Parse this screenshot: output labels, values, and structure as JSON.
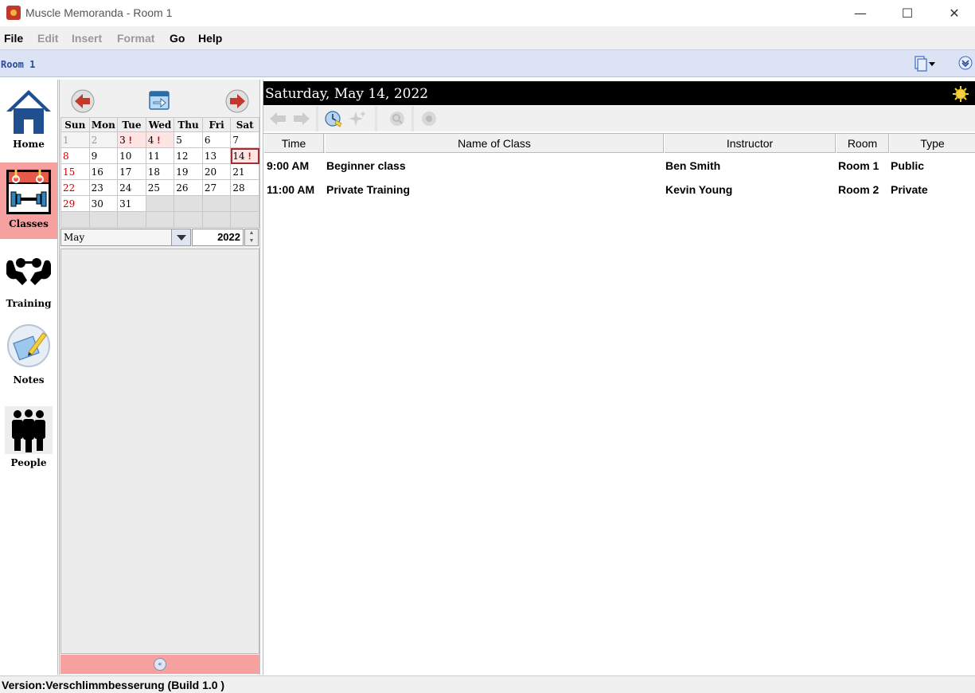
{
  "window": {
    "title": "Muscle Memoranda - Room 1",
    "controls": {
      "minimize": "—",
      "maximize": "☐",
      "close": "✕"
    }
  },
  "menu": {
    "items": [
      {
        "label": "File",
        "enabled": true
      },
      {
        "label": "Edit",
        "enabled": false
      },
      {
        "label": "Insert",
        "enabled": false
      },
      {
        "label": "Format",
        "enabled": false
      },
      {
        "label": "Go",
        "enabled": true
      },
      {
        "label": "Help",
        "enabled": true
      }
    ]
  },
  "room_bar": {
    "label": "Room 1"
  },
  "nav": {
    "items": [
      {
        "label": "Home",
        "icon": "home-icon",
        "active": false
      },
      {
        "label": "Classes",
        "icon": "classes-icon",
        "active": true
      },
      {
        "label": "Training",
        "icon": "training-icon",
        "active": false
      },
      {
        "label": "Notes",
        "icon": "notes-icon",
        "active": false
      },
      {
        "label": "People",
        "icon": "people-icon",
        "active": false
      }
    ]
  },
  "calendar": {
    "weekdays": [
      "Sun",
      "Mon",
      "Tue",
      "Wed",
      "Thu",
      "Fri",
      "Sat"
    ],
    "weeks": [
      [
        "1",
        "2",
        "3",
        "4",
        "5",
        "6",
        "7"
      ],
      [
        "8",
        "9",
        "10",
        "11",
        "12",
        "13",
        "14"
      ],
      [
        "15",
        "16",
        "17",
        "18",
        "19",
        "20",
        "21"
      ],
      [
        "22",
        "23",
        "24",
        "25",
        "26",
        "27",
        "28"
      ],
      [
        "29",
        "30",
        "31",
        "",
        "",
        "",
        ""
      ],
      [
        "",
        "",
        "",
        "",
        "",
        "",
        ""
      ]
    ],
    "event_marker": "!",
    "event_days": [
      "3",
      "4",
      "14"
    ],
    "selected_day": "14",
    "month": "May",
    "year": "2022",
    "accent_color": "#f7a0a0"
  },
  "main": {
    "date_header": "Saturday, May 14, 2022",
    "columns": [
      "Time",
      "Name of Class",
      "Instructor",
      "Room",
      "Type"
    ],
    "rows": [
      {
        "time": "9:00 AM",
        "name": "Beginner class",
        "instructor": "Ben Smith",
        "room": "Room 1",
        "type": "Public"
      },
      {
        "time": "11:00 AM",
        "name": "Private Training",
        "instructor": "Kevin Young",
        "room": "Room 2",
        "type": "Private"
      }
    ]
  },
  "status_bar": {
    "text": "Version:Verschlimmbesserung (Build 1.0 )"
  }
}
